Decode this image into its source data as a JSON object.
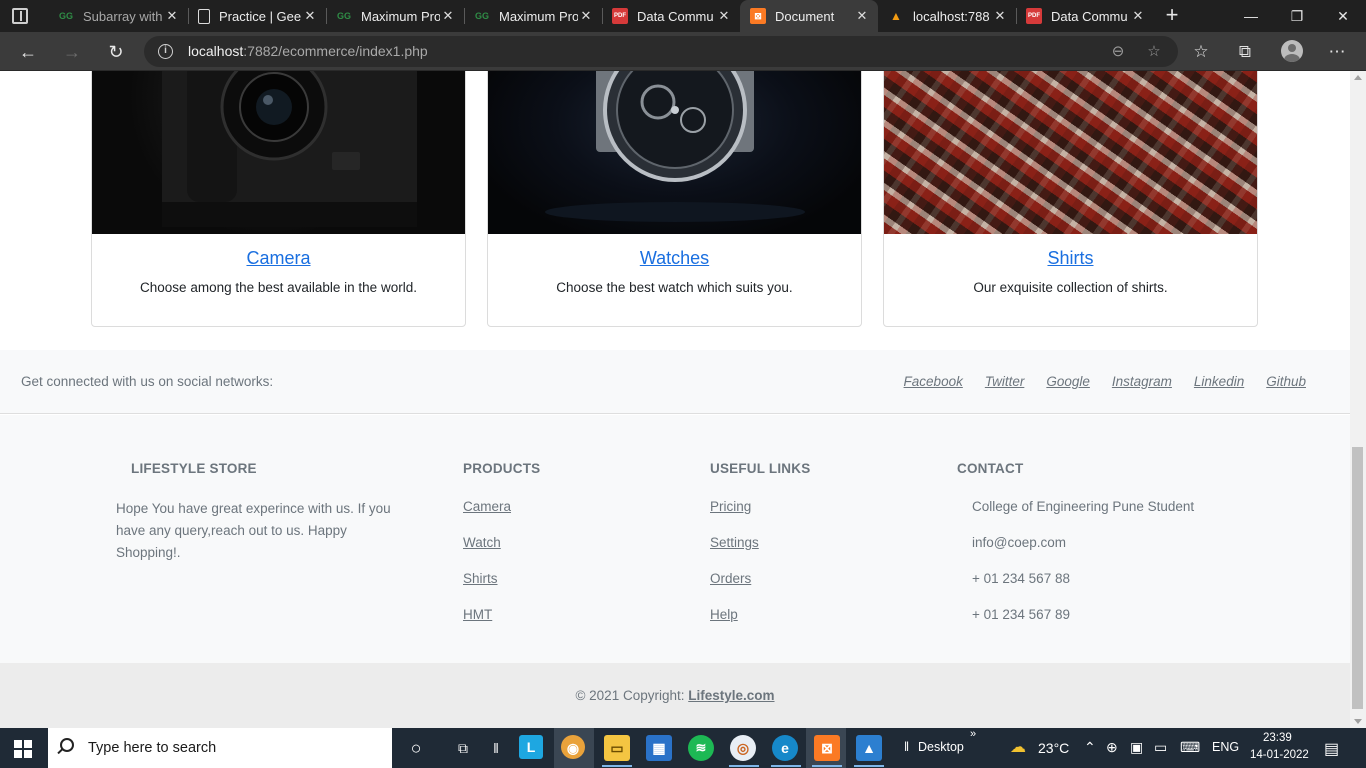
{
  "browser": {
    "tabs": [
      {
        "label": "Subarray with",
        "icon": "gfg-icon"
      },
      {
        "label": "Practice | Gee",
        "icon": "page-icon"
      },
      {
        "label": "Maximum Pro",
        "icon": "gfg-icon"
      },
      {
        "label": "Maximum Pro",
        "icon": "gfg-icon"
      },
      {
        "label": "Data Commu",
        "icon": "pdf-icon"
      },
      {
        "label": "Document",
        "icon": "xampp-icon"
      },
      {
        "label": "localhost:788",
        "icon": "phpmyadmin-icon"
      },
      {
        "label": "Data Commu",
        "icon": "pdf-icon"
      }
    ],
    "pdf_badge": "PDF",
    "active_tab_index": 5,
    "url_host": "localhost",
    "url_rest": ":7882/ecommerce/index1.php"
  },
  "cards": [
    {
      "title": "Camera",
      "description": "Choose among the best available in the world."
    },
    {
      "title": "Watches",
      "description": "Choose the best watch which suits you."
    },
    {
      "title": "Shirts",
      "description": "Our exquisite collection of shirts."
    }
  ],
  "social": {
    "text": "Get connected with us on social networks:",
    "links": [
      "Facebook",
      "Twitter",
      "Google",
      "Instagram",
      "Linkedin",
      "Github"
    ]
  },
  "footer": {
    "about": {
      "heading": "LIFESTYLE STORE",
      "text": "Hope You have great experince with us. If you have any query,reach out to us. Happy Shopping!."
    },
    "products": {
      "heading": "PRODUCTS",
      "links": [
        "Camera",
        "Watch",
        "Shirts",
        "HMT"
      ]
    },
    "useful_links": {
      "heading": "USEFUL LINKS",
      "links": [
        "Pricing",
        "Settings",
        "Orders",
        "Help"
      ]
    },
    "contact": {
      "heading": "CONTACT",
      "items": [
        "College of Engineering Pune Student",
        "info@coep.com",
        "+ 01 234 567 88",
        "+ 01 234 567 89"
      ]
    },
    "copyright_prefix": "© 2021 Copyright: ",
    "copyright_link": "Lifestyle.com"
  },
  "taskbar": {
    "search_placeholder": "Type here to search",
    "desktop_label": "Desktop",
    "temperature": "23°C",
    "language": "ENG",
    "time": "23:39",
    "date": "14-01-2022"
  }
}
